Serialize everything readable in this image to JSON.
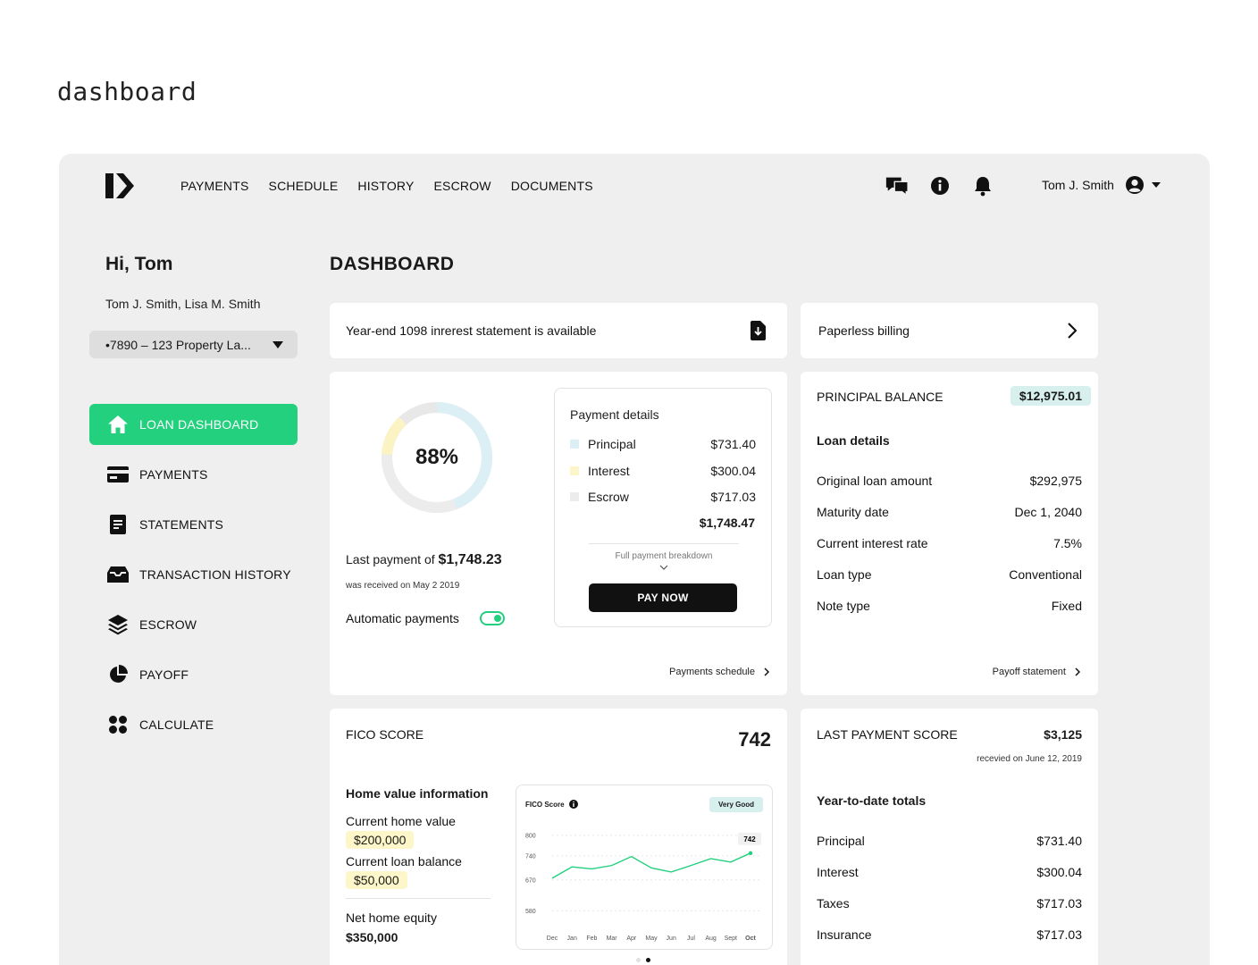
{
  "page_label": "dashboard",
  "nav": {
    "items": [
      "PAYMENTS",
      "SCHEDULE",
      "HISTORY",
      "ESCROW",
      "DOCUMENTS"
    ],
    "user_name": "Tom J. Smith"
  },
  "sidebar": {
    "greeting": "Hi, Tom",
    "owners": "Tom J. Smith, Lisa M. Smith",
    "property": "•7890 – 123 Property La...",
    "items": [
      {
        "label": "LOAN DASHBOARD",
        "icon": "home-icon",
        "active": true
      },
      {
        "label": "PAYMENTS",
        "icon": "credit-card-icon"
      },
      {
        "label": "STATEMENTS",
        "icon": "document-icon"
      },
      {
        "label": "TRANSACTION HISTORY",
        "icon": "inbox-icon"
      },
      {
        "label": "ESCROW",
        "icon": "layers-icon"
      },
      {
        "label": "PAYOFF",
        "icon": "pie-chart-icon"
      },
      {
        "label": "CALCULATE",
        "icon": "grid-dots-icon"
      }
    ]
  },
  "main": {
    "title": "DASHBOARD",
    "statement_notice": "Year-end 1098 inrerest statement is available",
    "paperless": "Paperless billing",
    "payment": {
      "progress_percent": 88,
      "progress_label": "88%",
      "last_payment_prefix": "Last payment of ",
      "last_payment_amount": "$1,748.23",
      "received": "was received on May 2 2019",
      "automatic_label": "Automatic payments",
      "automatic_on": true,
      "details_title": "Payment details",
      "details": [
        {
          "label": "Principal",
          "value": "$731.40",
          "color": "#dbeff5"
        },
        {
          "label": "Interest",
          "value": "$300.04",
          "color": "#fdf6c9"
        },
        {
          "label": "Escrow",
          "value": "$717.03",
          "color": "#ececec"
        }
      ],
      "total": "$1,748.47",
      "breakdown_link": "Full payment breakdown",
      "pay_now": "PAY NOW",
      "schedule_link": "Payments schedule"
    },
    "principal": {
      "title": "PRINCIPAL BALANCE",
      "value": "$12,975.01",
      "section": "Loan details",
      "rows": [
        {
          "label": "Original loan amount",
          "value": "$292,975"
        },
        {
          "label": "Maturity date",
          "value": "Dec 1, 2040"
        },
        {
          "label": "Current interest rate",
          "value": "7.5%"
        },
        {
          "label": "Loan type",
          "value": "Conventional"
        },
        {
          "label": "Note  type",
          "value": "Fixed"
        }
      ],
      "payoff_link": "Payoff statement"
    },
    "fico": {
      "title": "FICO SCORE",
      "score": "742",
      "home_title": "Home value information",
      "home_value_label": "Current home value",
      "home_value": "$200,000",
      "loan_balance_label": "Current loan balance",
      "loan_balance": "$50,000",
      "equity_label": "Net home equity",
      "equity": "$350,000",
      "chart_title": "FICO Score",
      "chart_badge": "Very Good",
      "chart_marker": "742"
    },
    "last_payment_score": {
      "title": "LAST PAYMENT SCORE",
      "value": "$3,125",
      "received": "recevied on June 12, 2019",
      "section": "Year-to-date totals",
      "rows": [
        {
          "label": "Principal",
          "value": "$731.40"
        },
        {
          "label": "Interest",
          "value": "$300.04"
        },
        {
          "label": "Taxes",
          "value": "$717.03"
        },
        {
          "label": "Insurance",
          "value": "$717.03"
        }
      ]
    }
  },
  "chart_data": {
    "type": "line",
    "title": "FICO Score",
    "categories": [
      "Dec",
      "Jan",
      "Feb",
      "Mar",
      "Apr",
      "May",
      "Jun",
      "Jul",
      "Aug",
      "Sept",
      "Oct"
    ],
    "yticks": [
      800,
      740,
      670,
      580
    ],
    "values": [
      675,
      708,
      702,
      712,
      738,
      705,
      693,
      712,
      732,
      722,
      748
    ],
    "ylim": [
      560,
      810
    ],
    "color": "#22d07d",
    "grid": true
  }
}
